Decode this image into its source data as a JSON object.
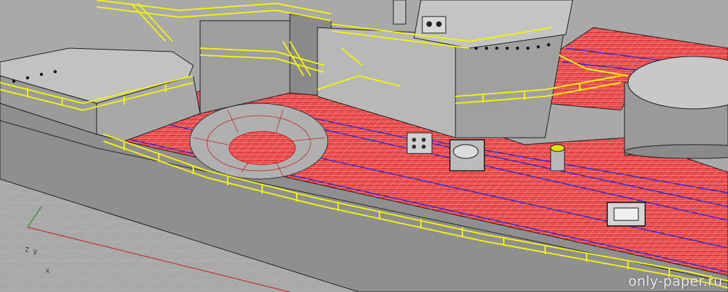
{
  "viewport": {
    "background_color": "#a9a9a9",
    "grid_color": "#b9b9b9",
    "x_axis_color": "#c03030",
    "y_axis_color": "#2e8b2e"
  },
  "axis_widget": {
    "z_label": "Z",
    "y_label": "y",
    "x_label": "x"
  },
  "model": {
    "hull_color": "#8f8f8f",
    "superstructure_color": "#b4b4b4",
    "deck_color": "#e23a3a",
    "deck_grid_color": "#ffffff",
    "plank_line_color": "#2a2ad0",
    "railing_color": "#f2f20a",
    "edge_color": "#1a1a1a"
  },
  "watermark": "only-paper.ru"
}
